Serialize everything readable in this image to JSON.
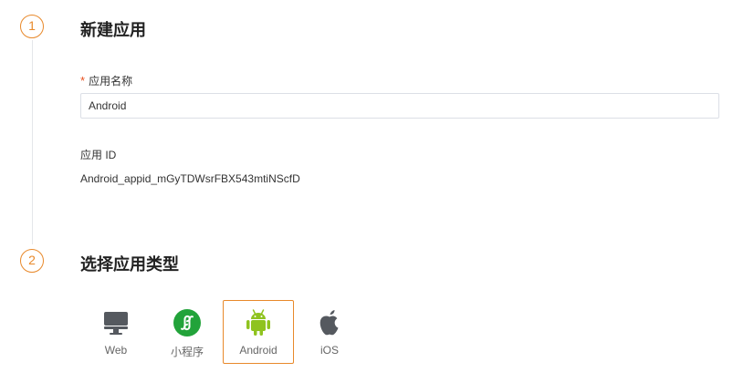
{
  "step1": {
    "number": "1",
    "title": "新建应用",
    "name_field": {
      "required_mark": "*",
      "label": "应用名称",
      "value": "Android"
    },
    "id_field": {
      "label": "应用 ID",
      "value": "Android_appid_mGyTDWsrFBX543mtiNScfD"
    }
  },
  "step2": {
    "number": "2",
    "title": "选择应用类型",
    "options": [
      {
        "label": "Web",
        "icon": "monitor-icon"
      },
      {
        "label": "小程序",
        "icon": "mini-program-icon"
      },
      {
        "label": "Android",
        "icon": "android-icon",
        "selected": true
      },
      {
        "label": "iOS",
        "icon": "apple-icon"
      }
    ]
  },
  "colors": {
    "accent": "#e8892b",
    "android_green": "#8fc31f",
    "mini_program_green": "#22a33a",
    "icon_gray": "#55595f"
  }
}
